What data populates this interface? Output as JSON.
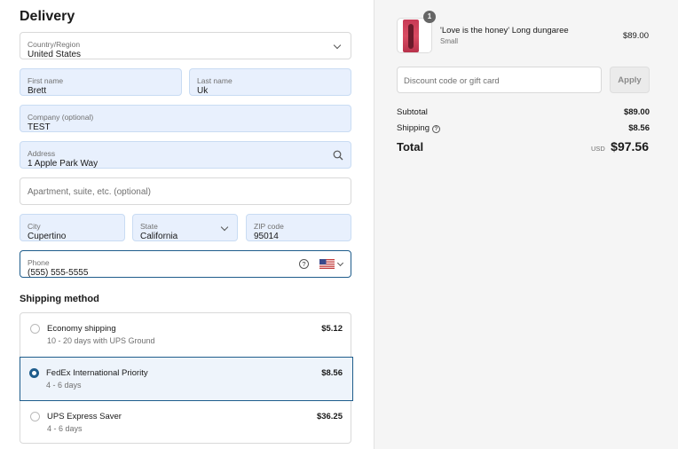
{
  "delivery": {
    "heading": "Delivery",
    "country": {
      "label": "Country/Region",
      "value": "United States"
    },
    "first_name": {
      "label": "First name",
      "value": "Brett"
    },
    "last_name": {
      "label": "Last name",
      "value": "Uk"
    },
    "company": {
      "label": "Company (optional)",
      "value": "TEST"
    },
    "address": {
      "label": "Address",
      "value": "1 Apple Park Way"
    },
    "apartment": {
      "placeholder": "Apartment, suite, etc. (optional)"
    },
    "city": {
      "label": "City",
      "value": "Cupertino"
    },
    "state": {
      "label": "State",
      "value": "California"
    },
    "zip": {
      "label": "ZIP code",
      "value": "95014"
    },
    "phone": {
      "label": "Phone",
      "value": "(555) 555-5555"
    }
  },
  "shipping": {
    "heading": "Shipping method",
    "options": [
      {
        "name": "Economy shipping",
        "detail": "10 - 20 days with UPS Ground",
        "price": "$5.12",
        "selected": false
      },
      {
        "name": "FedEx International Priority",
        "detail": "4 - 6 days",
        "price": "$8.56",
        "selected": true
      },
      {
        "name": "UPS Express Saver",
        "detail": "4 - 6 days",
        "price": "$36.25",
        "selected": false
      }
    ]
  },
  "summary": {
    "item": {
      "quantity": "1",
      "name": "'Love is the honey' Long dungaree",
      "variant": "Small",
      "price": "$89.00"
    },
    "discount_placeholder": "Discount code or gift card",
    "apply_label": "Apply",
    "subtotal": {
      "label": "Subtotal",
      "value": "$89.00"
    },
    "shipping": {
      "label": "Shipping",
      "value": "$8.56"
    },
    "total": {
      "label": "Total",
      "currency": "USD",
      "value": "$97.56"
    }
  }
}
